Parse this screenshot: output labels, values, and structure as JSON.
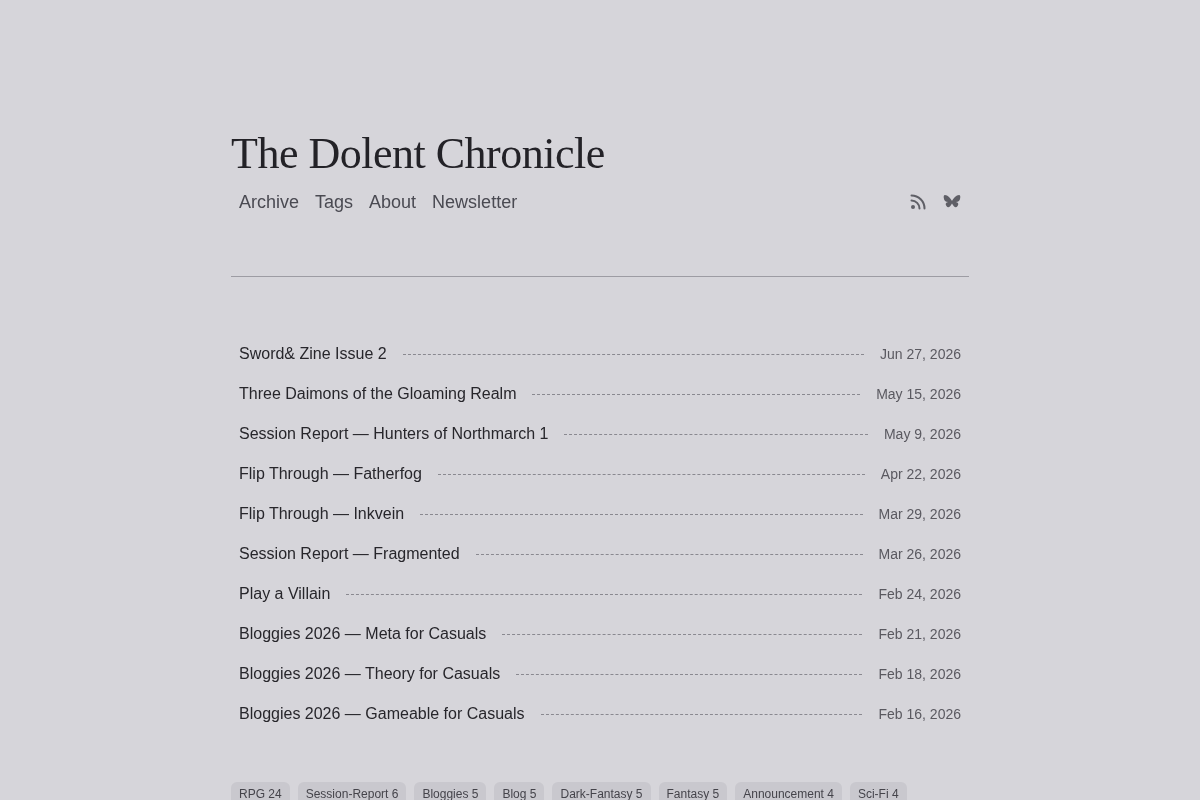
{
  "site": {
    "title": "The Dolent Chronicle"
  },
  "nav": [
    "Archive",
    "Tags",
    "About",
    "Newsletter"
  ],
  "posts": [
    {
      "title": "Sword& Zine Issue 2",
      "date": "Jun 27, 2026"
    },
    {
      "title": "Three Daimons of the Gloaming Realm",
      "date": "May 15, 2026"
    },
    {
      "title": "Session Report — Hunters of Northmarch 1",
      "date": "May 9, 2026"
    },
    {
      "title": "Flip Through — Fatherfog",
      "date": "Apr 22, 2026"
    },
    {
      "title": "Flip Through — Inkvein",
      "date": "Mar 29, 2026"
    },
    {
      "title": "Session Report — Fragmented",
      "date": "Mar 26, 2026"
    },
    {
      "title": "Play a Villain",
      "date": "Feb 24, 2026"
    },
    {
      "title": "Bloggies 2026 — Meta for Casuals",
      "date": "Feb 21, 2026"
    },
    {
      "title": "Bloggies 2026 — Theory for Casuals",
      "date": "Feb 18, 2026"
    },
    {
      "title": "Bloggies 2026 — Gameable for Casuals",
      "date": "Feb 16, 2026"
    }
  ],
  "tags": [
    "RPG 24",
    "Session-Report 6",
    "Bloggies 5",
    "Blog 5",
    "Dark-Fantasy 5",
    "Fantasy 5",
    "Announcement 4",
    "Sci-Fi 4"
  ]
}
